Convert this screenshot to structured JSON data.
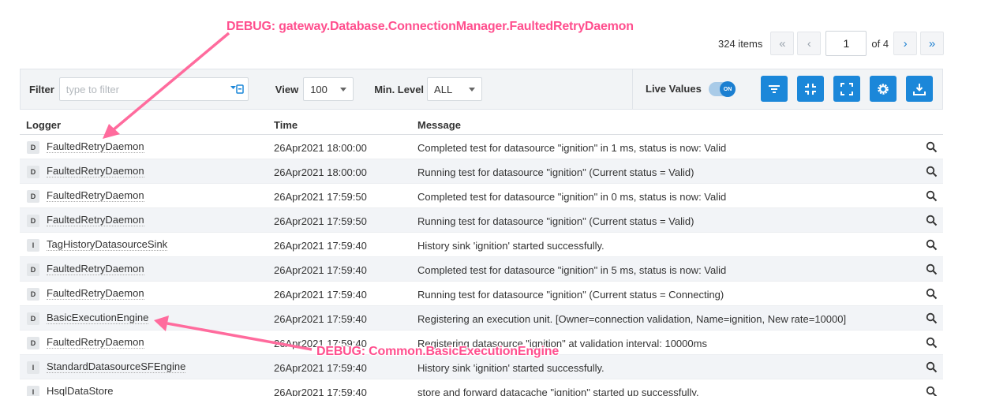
{
  "pager": {
    "count": "324 items",
    "first": "«",
    "prev": "‹",
    "page": "1",
    "of": "of 4",
    "next": "›",
    "last": "»"
  },
  "toolbar": {
    "filter_label": "Filter",
    "filter_placeholder": "type to filter",
    "view_label": "View",
    "view_value": "100",
    "level_label": "Min. Level",
    "level_value": "ALL",
    "live_label": "Live Values",
    "toggle_text": "ON",
    "accent": "#1b87d9"
  },
  "table": {
    "headers": {
      "logger": "Logger",
      "time": "Time",
      "message": "Message"
    },
    "rows": [
      {
        "level": "D",
        "logger": "FaultedRetryDaemon",
        "time": "26Apr2021 18:00:00",
        "message": "Completed test for datasource \"ignition\" in 1 ms, status is now: Valid"
      },
      {
        "level": "D",
        "logger": "FaultedRetryDaemon",
        "time": "26Apr2021 18:00:00",
        "message": "Running test for datasource \"ignition\" (Current status = Valid)"
      },
      {
        "level": "D",
        "logger": "FaultedRetryDaemon",
        "time": "26Apr2021 17:59:50",
        "message": "Completed test for datasource \"ignition\" in 0 ms, status is now: Valid"
      },
      {
        "level": "D",
        "logger": "FaultedRetryDaemon",
        "time": "26Apr2021 17:59:50",
        "message": "Running test for datasource \"ignition\" (Current status = Valid)"
      },
      {
        "level": "I",
        "logger": "TagHistoryDatasourceSink",
        "time": "26Apr2021 17:59:40",
        "message": "History sink 'ignition' started successfully."
      },
      {
        "level": "D",
        "logger": "FaultedRetryDaemon",
        "time": "26Apr2021 17:59:40",
        "message": "Completed test for datasource \"ignition\" in 5 ms, status is now: Valid"
      },
      {
        "level": "D",
        "logger": "FaultedRetryDaemon",
        "time": "26Apr2021 17:59:40",
        "message": "Running test for datasource \"ignition\" (Current status = Connecting)"
      },
      {
        "level": "D",
        "logger": "BasicExecutionEngine",
        "time": "26Apr2021 17:59:40",
        "message": "Registering an execution unit. [Owner=connection validation, Name=ignition, New rate=10000]"
      },
      {
        "level": "D",
        "logger": "FaultedRetryDaemon",
        "time": "26Apr2021 17:59:40",
        "message": "Registering datasource \"ignition\" at validation interval: 10000ms"
      },
      {
        "level": "I",
        "logger": "StandardDatasourceSFEngine",
        "time": "26Apr2021 17:59:40",
        "message": "History sink 'ignition' started successfully."
      },
      {
        "level": "I",
        "logger": "HsqlDataStore",
        "time": "26Apr2021 17:59:40",
        "message": "store and forward datacache \"ignition\" started up successfully."
      }
    ]
  },
  "annotations": {
    "top": "DEBUG:  gateway.Database.ConnectionManager.FaultedRetryDaemon",
    "bottom": "DEBUG: Common.BasicExecutionEngine",
    "color": "#ff4f8e"
  }
}
